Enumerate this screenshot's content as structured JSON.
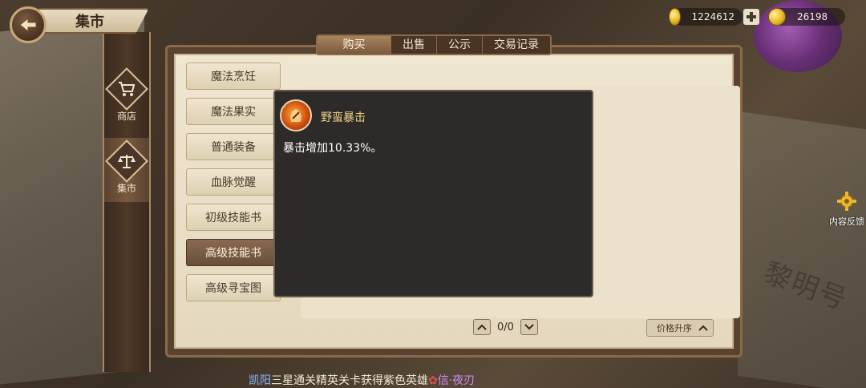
{
  "header": {
    "title": "集市"
  },
  "nav": [
    {
      "label": "商店",
      "icon": "shopping-cart-icon",
      "active": false
    },
    {
      "label": "集市",
      "icon": "scales-icon",
      "active": true
    }
  ],
  "tabs": [
    {
      "label": "购买",
      "active": true
    },
    {
      "label": "出售",
      "active": false
    },
    {
      "label": "公示",
      "active": false
    },
    {
      "label": "交易记录",
      "active": false
    }
  ],
  "categories": [
    {
      "label": "魔法烹饪",
      "active": false
    },
    {
      "label": "魔法果实",
      "active": false
    },
    {
      "label": "普通装备",
      "active": false
    },
    {
      "label": "血脉觉醒",
      "active": false
    },
    {
      "label": "初级技能书",
      "active": false
    },
    {
      "label": "高级技能书",
      "active": true
    },
    {
      "label": "高级寻宝图",
      "active": false
    }
  ],
  "tooltip": {
    "skill_name": "野蛮暴击",
    "description": "暴击增加10.33%。"
  },
  "pagination": {
    "text": "0/0"
  },
  "sort": {
    "label": "价格升序"
  },
  "currency": {
    "gold": "1224612",
    "diamond": "26198"
  },
  "feedback": {
    "label": "内容反馈"
  },
  "ticker": {
    "player": "凯阳",
    "message": "三星通关精英关卡获得紫色英雄",
    "hero": "信·夜刃"
  },
  "background": {
    "book_text": "黎明号"
  },
  "colors": {
    "panel_bg": "#efe6d2",
    "tooltip_bg": "#2d2b29",
    "skill_name": "#f0d28a",
    "active_category": "#6a4e3a"
  }
}
